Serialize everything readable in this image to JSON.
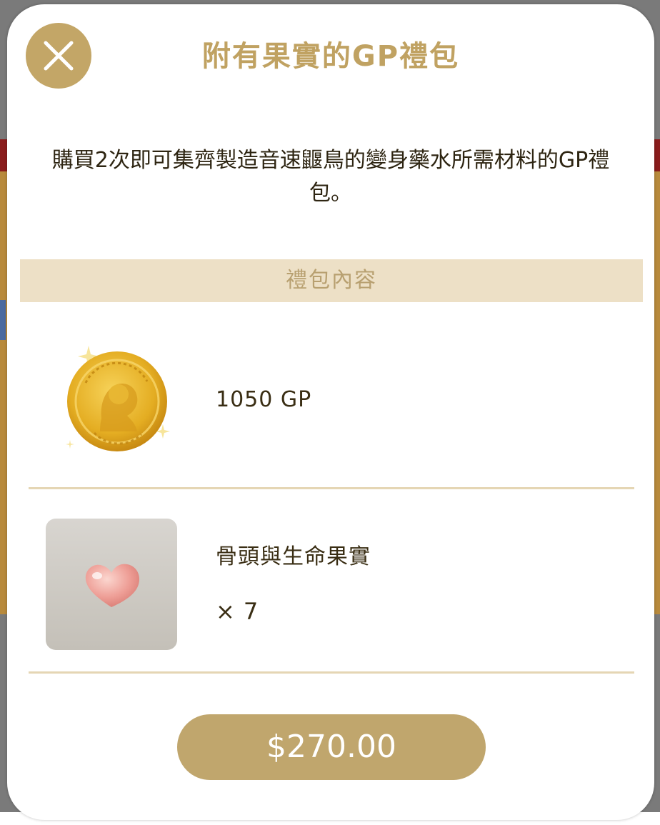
{
  "modal": {
    "title": "附有果實的GP禮包",
    "description": "購買2次即可集齊製造音速鼴鳥的變身藥水所需材料的GP禮包。",
    "section_header": "禮包內容",
    "items": [
      {
        "name": "1050 GP",
        "icon": "gold-coin-icon"
      },
      {
        "name": "骨頭與生命果實",
        "quantity_symbol": "×",
        "quantity": "7",
        "icon": "heart-fruit-icon"
      }
    ],
    "price_label": "$270.00",
    "close_icon": "close-icon"
  },
  "colors": {
    "accent_gold": "#c0a262",
    "button_gold": "#c0a66d",
    "section_bg": "#ede0c6",
    "divider": "#e5d6b4",
    "text_dark": "#2e2512"
  }
}
